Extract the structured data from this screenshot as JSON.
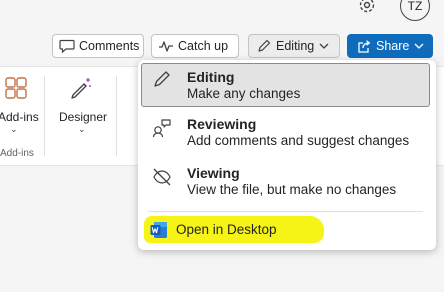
{
  "header": {
    "avatar_initials": "TZ",
    "comments_label": "Comments",
    "catchup_label": "Catch up",
    "editing_label": "Editing",
    "share_label": "Share",
    "share_color": "#0f6cbd"
  },
  "ribbon": {
    "addins_label": "Add-ins",
    "addins_group_label": "Add-ins",
    "designer_label": "Designer"
  },
  "mode_menu": {
    "items": [
      {
        "title": "Editing",
        "description": "Make any changes",
        "icon": "pencil-icon",
        "selected": true
      },
      {
        "title": "Reviewing",
        "description": "Add comments and suggest changes",
        "icon": "reviewing-icon",
        "selected": false
      },
      {
        "title": "Viewing",
        "description": "View the file, but make no changes",
        "icon": "eye-off-icon",
        "selected": false
      }
    ],
    "open_desktop_label": "Open in Desktop",
    "highlight_color": "#f5f20a"
  }
}
